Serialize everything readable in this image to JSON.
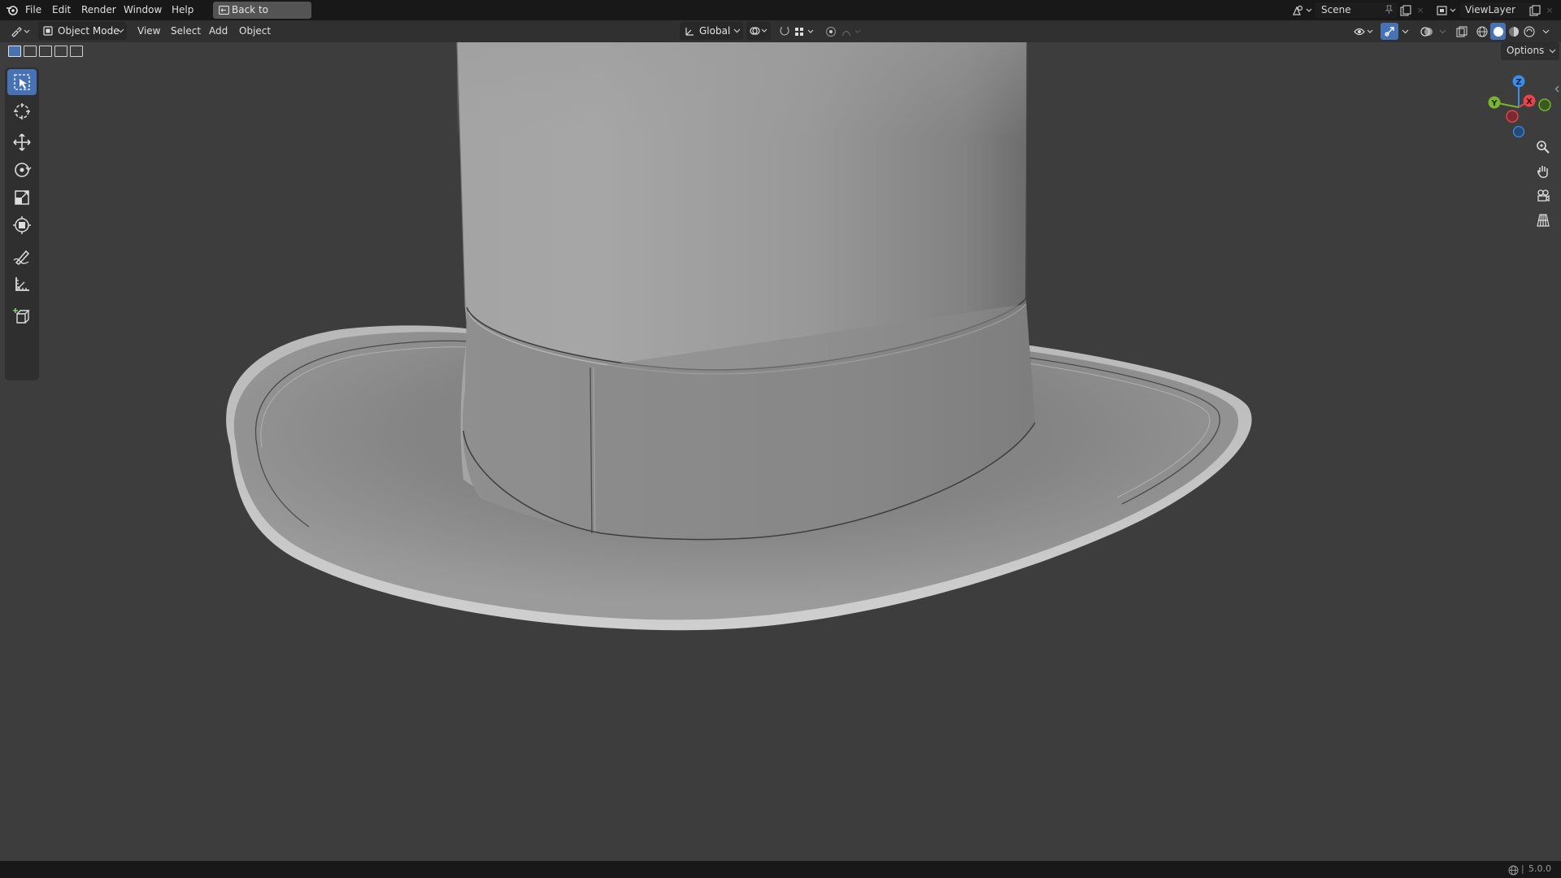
{
  "topbar": {
    "menu": [
      "File",
      "Edit",
      "Render",
      "Window",
      "Help"
    ],
    "back_button": "Back to Previous",
    "scene": "Scene",
    "view_layer": "ViewLayer"
  },
  "header": {
    "mode": "Object Mode",
    "menu": [
      "View",
      "Select",
      "Add",
      "Object"
    ],
    "transform_orientation": "Global",
    "options": "Options"
  },
  "toolbar": {
    "tools": [
      "select-box",
      "cursor",
      "move",
      "rotate",
      "scale",
      "transform",
      "annotate",
      "measure",
      "add-cube"
    ],
    "active_tool": "select-box"
  },
  "gizmo": {
    "axes": [
      "Z",
      "X",
      "Y"
    ],
    "colors": {
      "x": "#e8444e",
      "y": "#7ab532",
      "z": "#3b8ee8"
    }
  },
  "statusbar": {
    "version": "5.0.0"
  },
  "colors": {
    "accent": "#4772b3",
    "viewport_bg": "#3d3d3d",
    "topbar_bg": "#181818"
  }
}
